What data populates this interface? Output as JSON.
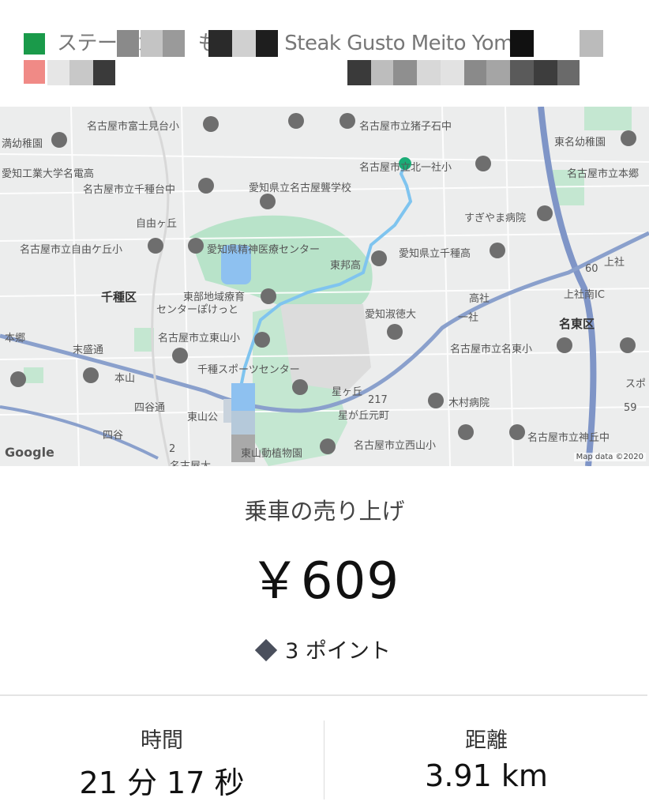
{
  "header": {
    "pickup_text": "ステーキガス　もぎ台店 Steak Gusto Meito Yom..."
  },
  "map": {
    "labels": [
      "名古屋市富士見台小",
      "名古屋市立猪子石中",
      "満幼稚園",
      "東名幼稚園",
      "愛知工業大学名電高",
      "名古屋市立北一社小",
      "名古屋市立千種台中",
      "愛知県立名古屋聾学校",
      "名古屋市立本郷",
      "自由ヶ丘",
      "すぎやま病院",
      "名古屋市立自由ケ丘小",
      "愛知県精神医療センター",
      "東邦高",
      "愛知県立千種高",
      "上社",
      "千種区",
      "東部地域療育",
      "センターぽけっと",
      "高社",
      "上社南IC",
      "愛知淑徳大",
      "一社",
      "名東区",
      "名古屋市立東山小",
      "本郷",
      "名古屋市立名東小",
      "本山",
      "千種スポーツセンター",
      "星ヶ丘",
      "四谷通",
      "木村病院",
      "東山公",
      "星が丘元町",
      "名古屋市立西山小",
      "名古屋市立神丘中",
      "東山動植物園",
      "末盛通",
      "四谷",
      "名古屋大",
      "スポ",
      "60",
      "217",
      "59",
      "2"
    ],
    "logo": "Google",
    "attribution": "Map data ©2020"
  },
  "summary": {
    "caption": "乗車の売り上げ",
    "fare": "￥609",
    "points": "3 ポイント"
  },
  "stats": {
    "time_label": "時間",
    "time_value": "21 分 17 秒",
    "distance_label": "距離",
    "distance_value": "3.91 km"
  }
}
